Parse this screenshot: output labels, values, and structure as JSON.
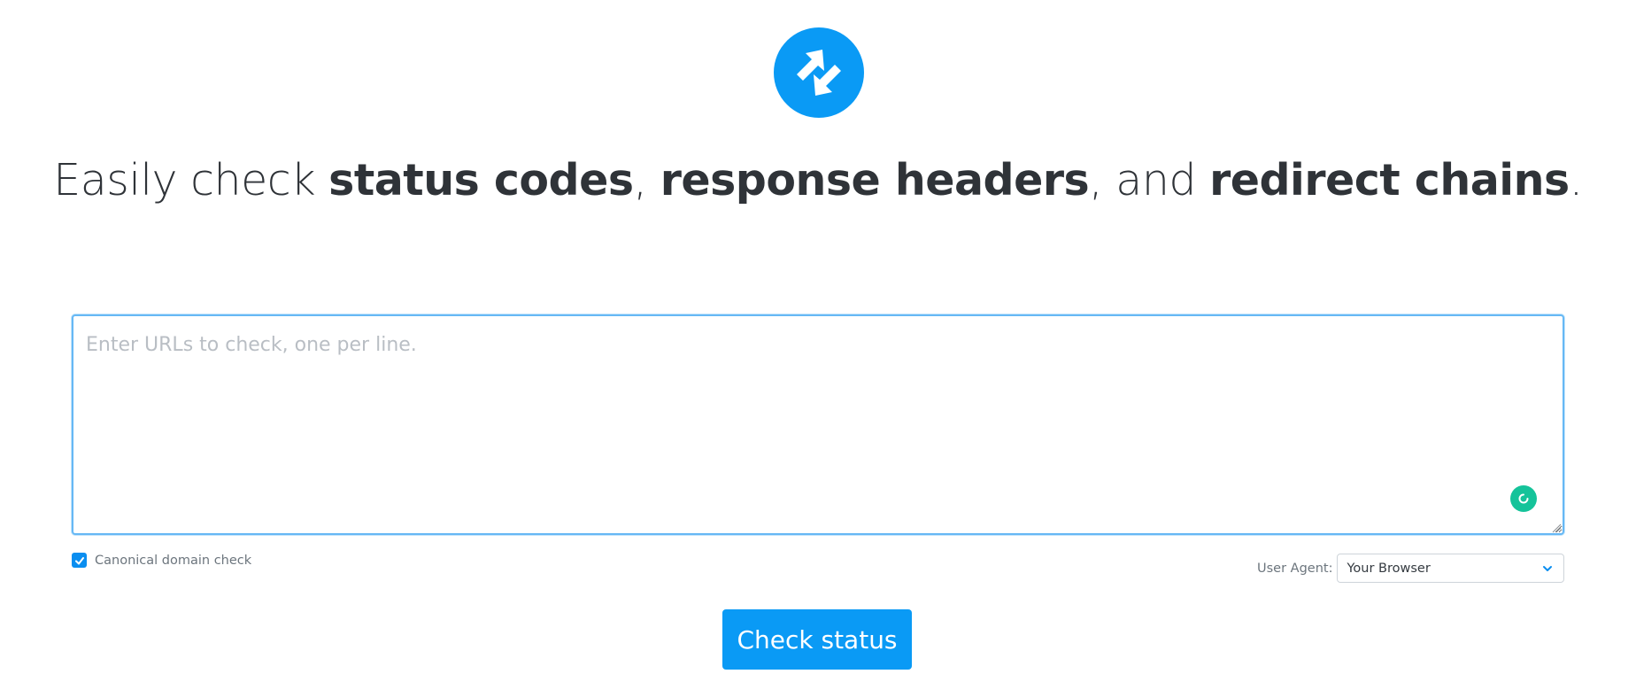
{
  "colors": {
    "brand": "#0a9af5",
    "grammarly": "#15c39a",
    "text": "#2f3338",
    "muted": "#6c757d"
  },
  "logo": {
    "icon": "redirect-arrows-icon"
  },
  "headline": {
    "part1": "Easily check ",
    "bold1": "status codes",
    "part2": ", ",
    "bold2": "response headers",
    "part3": ", and ",
    "bold3": "redirect chains",
    "part4": "."
  },
  "url_input": {
    "value": "",
    "placeholder": "Enter URLs to check, one per line."
  },
  "options": {
    "canonical_label": "Canonical domain check",
    "canonical_checked": true,
    "user_agent_label": "User Agent:",
    "user_agent_value": "Your Browser"
  },
  "actions": {
    "check_label": "Check status"
  }
}
